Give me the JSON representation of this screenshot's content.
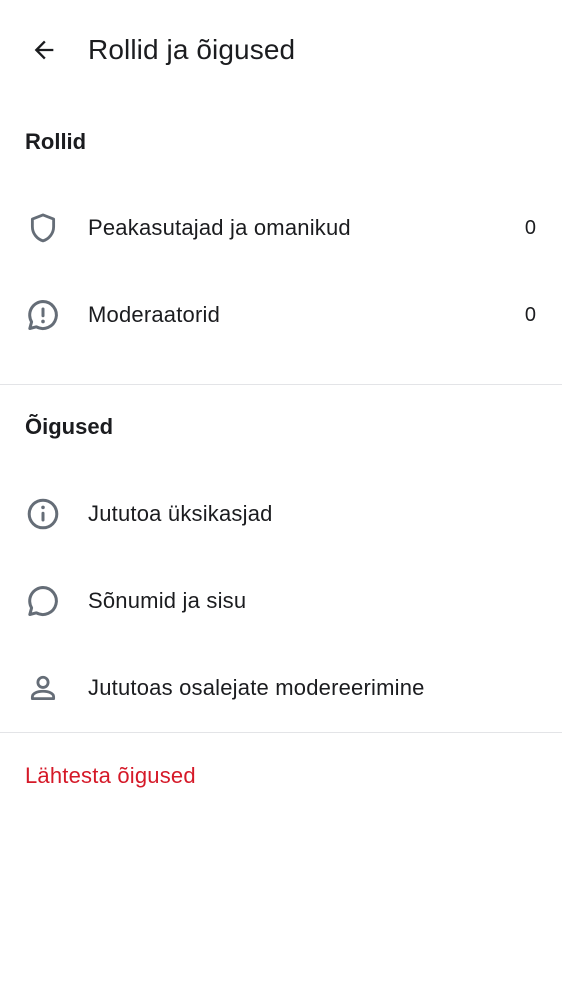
{
  "header": {
    "title": "Rollid ja õigused",
    "back_icon": "arrow-left-icon"
  },
  "roles_section": {
    "title": "Rollid",
    "items": [
      {
        "label": "Peakasutajad ja omanikud",
        "count": "0",
        "icon": "shield-icon"
      },
      {
        "label": "Moderaatorid",
        "count": "0",
        "icon": "chat-alert-icon"
      }
    ]
  },
  "permissions_section": {
    "title": "Õigused",
    "items": [
      {
        "label": "Jututoa üksikasjad",
        "icon": "info-icon"
      },
      {
        "label": "Sõnumid ja sisu",
        "icon": "chat-bubble-icon"
      },
      {
        "label": "Jututoas osalejate modereerimine",
        "icon": "person-icon"
      }
    ]
  },
  "reset": {
    "label": "Lähtesta õigused"
  },
  "colors": {
    "text": "#1b1c1f",
    "icon": "#656d77",
    "divider": "#e3e4e7",
    "danger": "#d51928",
    "background": "#ffffff"
  }
}
